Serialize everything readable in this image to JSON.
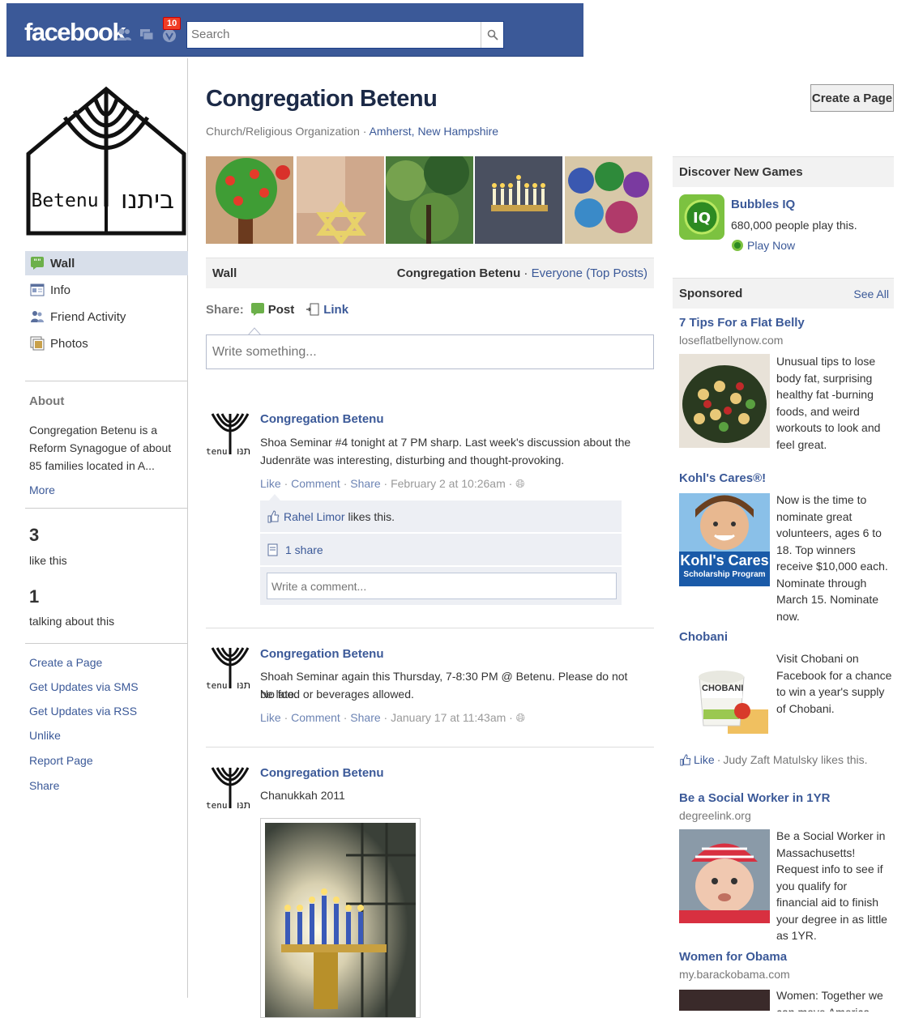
{
  "header": {
    "logo": "facebook",
    "notification_count": "10",
    "search_placeholder": "Search"
  },
  "sidebar": {
    "nav": [
      {
        "label": "Wall",
        "icon": "wall-icon",
        "active": true
      },
      {
        "label": "Info",
        "icon": "info-icon"
      },
      {
        "label": "Friend Activity",
        "icon": "friends-icon"
      },
      {
        "label": "Photos",
        "icon": "photos-icon"
      }
    ],
    "about_heading": "About",
    "about_text": "Congregation Betenu is a Reform Synagogue of about 85 families located in A...",
    "more": "More",
    "likes_count": "3",
    "likes_label": "like this",
    "talking_count": "1",
    "talking_label": "talking about this",
    "links": [
      "Create a Page",
      "Get Updates via SMS",
      "Get Updates via RSS",
      "Unlike",
      "Report Page",
      "Share"
    ]
  },
  "page": {
    "title": "Congregation Betenu",
    "category": "Church/Religious Organization",
    "location": "Amherst, New Hampshire",
    "logo_text_en": "Betenu",
    "logo_text_he": "ביתנו"
  },
  "wall": {
    "label": "Wall",
    "owner": "Congregation Betenu",
    "filter": "Everyone (Top Posts)",
    "share_label": "Share:",
    "post_label": "Post",
    "link_label": "Link",
    "write_placeholder": "Write something..."
  },
  "posts": [
    {
      "author": "Congregation Betenu",
      "text_line1": "Shoa Seminar #4 tonight at 7 PM sharp. Last week's discussion about the",
      "text_line2": "Judenräte was interesting, disturbing and thought-provoking.",
      "like": "Like",
      "comment": "Comment",
      "share": "Share",
      "time": "February 2 at 10:26am",
      "liker": "Rahel Limor",
      "likes_suffix": "likes this.",
      "shares": "1 share",
      "comment_placeholder": "Write a comment..."
    },
    {
      "author": "Congregation Betenu",
      "text_line1": "Shoah Seminar again this Thursday, 7-8:30 PM @ Betenu. Please do not be late.",
      "text_line2": "No food or beverages allowed.",
      "like": "Like",
      "comment": "Comment",
      "share": "Share",
      "time": "January 17 at 11:43am"
    },
    {
      "author": "Congregation Betenu",
      "text_line1": "Chanukkah 2011"
    }
  ],
  "avatar_text": {
    "left": "tenu",
    "right": "ּתנו"
  },
  "right": {
    "create_page": "Create a Page",
    "games_heading": "Discover New Games",
    "game": {
      "title": "Bubbles IQ",
      "players": "680,000 people play this.",
      "play": "Play Now"
    },
    "sponsored": "Sponsored",
    "see_all": "See All",
    "ads": [
      {
        "title": "7 Tips For a Flat Belly",
        "domain": "loseflatbellynow.com",
        "body": "Unusual tips to lose body fat, surprising healthy fat -burning foods, and weird workouts to look and feel great."
      },
      {
        "title": "Kohl's Cares®!",
        "domain": "",
        "body": "Now is the time to nominate great volunteers, ages 6 to 18. Top winners receive $10,000 each. Nominate through March 15. Nominate now.",
        "img_text1": "Kohl's Cares",
        "img_text2": "Scholarship Program"
      },
      {
        "title": "Chobani",
        "domain": "",
        "body": "Visit Chobani on Facebook for a chance to win a year's supply of Chobani.",
        "img_text": "CHOBANI",
        "like": "Like",
        "social": "Judy Zaft Matulsky likes this."
      },
      {
        "title": "Be a Social Worker in 1YR",
        "domain": "degreelink.org",
        "body": "Be a Social Worker in Massachusetts! Request info to see if you qualify for financial aid to finish your degree in as little as 1YR."
      },
      {
        "title": "Women for Obama",
        "domain": "my.barackobama.com",
        "body": "Women: Together we can move America forward for"
      }
    ]
  }
}
